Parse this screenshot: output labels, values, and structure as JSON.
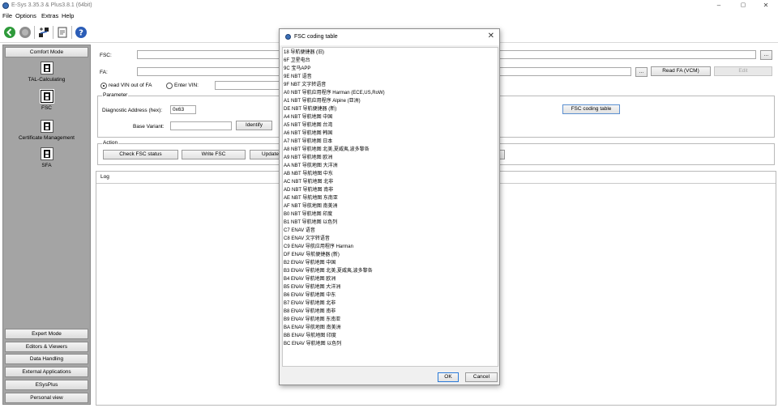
{
  "window": {
    "title": "E-Sys 3.35.3 & Plus3.8.1  (64bit)",
    "minimize": "–",
    "maximize": "▢",
    "close": "✕"
  },
  "menu": [
    "File",
    "Options",
    "Extras",
    "Help"
  ],
  "toolbar": {
    "icons": [
      "go-icon",
      "stop-icon",
      "connect-icon",
      "document-icon",
      "help-icon"
    ],
    "colors": {
      "go": "#2e9a3a",
      "stop": "#8f8f8f",
      "help": "#2b5db7"
    }
  },
  "left_panel": {
    "mode": "Comfort Mode",
    "items": [
      {
        "label": "TAL-Calculating",
        "icon": "chip-icon"
      },
      {
        "label": "FSC",
        "icon": "chip-icon",
        "selected": true
      },
      {
        "label": "Certificate Management",
        "icon": "chip-icon"
      },
      {
        "label": "SFA",
        "icon": "chip-icon"
      }
    ],
    "modes": [
      "Expert Mode",
      "Editors & Viewers",
      "Data Handling",
      "External Applications",
      "ESysPlus",
      "Personal view"
    ]
  },
  "form": {
    "fsc_label": "FSC:",
    "fsc_value": "",
    "fsc_browse": "...",
    "fa_label": "FA:",
    "fa_value": "",
    "fa_browse": "...",
    "read_fa_button": "Read FA (VCM)",
    "edit_button": "Edit",
    "radio_read_vin": "read VIN out of FA",
    "radio_enter_vin": "Enter VIN:",
    "vin_value": ""
  },
  "parameter": {
    "title": "Parameter",
    "diag_label": "Diagnostic Address (hex):",
    "diag_value": "0x63",
    "base_label": "Base Variant:",
    "base_value": "",
    "identify_button": "Identify",
    "fsc_table_button": "FSC coding table"
  },
  "action": {
    "title": "Action",
    "check_button": "Check FSC status",
    "write_button": "Write FSC",
    "update_button": "Update"
  },
  "log": {
    "title": "Log"
  },
  "dialog": {
    "title": "FSC coding table",
    "close": "✕",
    "rows": [
      "18 导航便捷器 (旧)",
      "6F 卫星电台",
      "9C 宝马APP",
      "9E NBT 语音",
      "9F NBT 文字转语音",
      "A0 NBT 导航应用程序 Harman (ECE,US,RoW)",
      "A1 NBT 导航应用程序 Alpine (亚洲)",
      "DE NBT 导航便捷器 (新)",
      "A4 NBT 导航地图 中国",
      "A5 NBT 导航地图 台湾",
      "A6 NBT 导航地图 韩国",
      "A7 NBT 导航地图 日本",
      "A8 NBT 导航地图 北美,夏威夷,波多黎各",
      "A9 NBT 导航地图 欧洲",
      "AA NBT 导航地图 大洋洲",
      "AB NBT 导航地图 中东",
      "AC NBT 导航地图 北非",
      "AD NBT 导航地图 南非",
      "AE NBT 导航地图 东南亚",
      "AF NBT 导航地图 南美洲",
      "B0 NBT 导航地图 印度",
      "B1 NBT 导航地图 以色列",
      "C7 ENAV 语音",
      "C8 ENAV 文字转语音",
      "C9 ENAV 导航应用程序 Harman",
      "DF ENAV 导航便捷器 (新)",
      "B2 ENAV 导航地图 中国",
      "B3 ENAV 导航地图 北美,夏威夷,波多黎各",
      "B4 ENAV 导航地图 欧洲",
      "B5 ENAV 导航地图 大洋洲",
      "B6 ENAV 导航地图 中东",
      "B7 ENAV 导航地图 北非",
      "B8 ENAV 导航地图 南非",
      "B9 ENAV 导航地图 东南亚",
      "BA ENAV 导航地图 南美洲",
      "BB ENAV 导航地图 印度",
      "BC ENAV 导航地图 以色列"
    ],
    "ok_button": "OK",
    "cancel_button": "Cancel"
  }
}
